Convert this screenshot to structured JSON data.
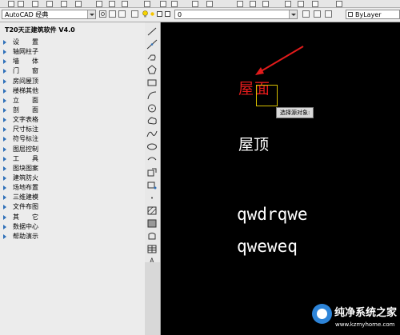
{
  "toolbar": {
    "workspace_value": "AutoCAD 经典",
    "layer_value": "0",
    "linetype_value": "ByLayer"
  },
  "palette": {
    "title": "T20天正建筑软件 V4.0",
    "items": [
      "设　　置",
      "轴网柱子",
      "墙　　体",
      "门　　窗",
      "房间屋顶",
      "楼梯其他",
      "立　　面",
      "剖　　面",
      "文字表格",
      "尺寸标注",
      "符号标注",
      "图层控制",
      "工　　具",
      "图块图案",
      "建筑防火",
      "场地布置",
      "三维建模",
      "文件布图",
      "其　　它",
      "数据中心",
      "帮助演示"
    ]
  },
  "canvas": {
    "selected_text": "屋面",
    "tooltip": "选择源对象:",
    "text_roof": "屋顶",
    "text_line1": "qwdrqwe",
    "text_line2": "qweweq"
  },
  "watermark": {
    "line1": "纯净系统之家",
    "line2": "www.kzmyhome.com"
  },
  "colors": {
    "canvas_bg": "#000000",
    "selected_text": "#e21b1b",
    "arrow": "#e21b1b",
    "pick_box": "#d8c000",
    "menu_triangle": "#2e6fb8"
  },
  "icons": [
    "gear-icon",
    "bulb-icon",
    "sun-icon",
    "layer-swatch-icon",
    "line-tool-icon",
    "polyline-tool-icon",
    "polygon-tool-icon",
    "rectangle-tool-icon",
    "arc-tool-icon",
    "circle-tool-icon",
    "cloud-tool-icon",
    "spline-tool-icon",
    "ellipse-tool-icon",
    "block-tool-icon",
    "point-tool-icon",
    "hatch-tool-icon",
    "gradient-tool-icon",
    "region-tool-icon",
    "table-tool-icon",
    "mtext-tool-icon"
  ]
}
